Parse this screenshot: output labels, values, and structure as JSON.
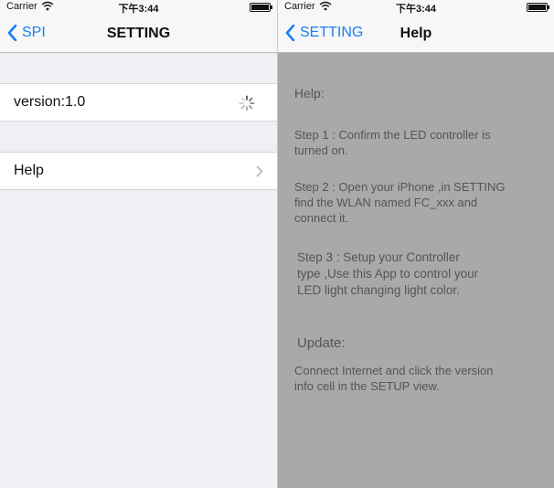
{
  "left": {
    "status": {
      "carrier": "Carrier",
      "time": "下午3:44"
    },
    "nav": {
      "back_label": "SPI",
      "title": "SETTING"
    },
    "cells": {
      "version": "version:1.0",
      "help": "Help"
    }
  },
  "right": {
    "status": {
      "carrier": "Carrier",
      "time": "下午3:44"
    },
    "nav": {
      "back_label": "SETTING",
      "title": "Help"
    },
    "content": {
      "help_heading": "Help:",
      "step1": [
        "Step 1 : Confirm the LED controller is",
        "turned on."
      ],
      "step2": [
        "Step 2 : Open your iPhone ,in SETTING",
        "find the WLAN named FC_xxx and",
        "connect it."
      ],
      "step3": [
        "Step 3 : Setup your Controller",
        "type ,Use this App to control your",
        "LED light changing light color."
      ],
      "update_heading": "Update:",
      "update_text": [
        "Connect Internet and click the version",
        "info cell in the SETUP view."
      ]
    }
  },
  "colors": {
    "accent": "#1a7ef5",
    "help_background": "#a9a9a9",
    "table_background": "#efeff4"
  },
  "icons": {
    "back": "chevron-left-icon",
    "disclosure": "chevron-right-icon",
    "loading": "spinner-icon",
    "wifi": "wifi-icon",
    "battery": "battery-icon"
  }
}
